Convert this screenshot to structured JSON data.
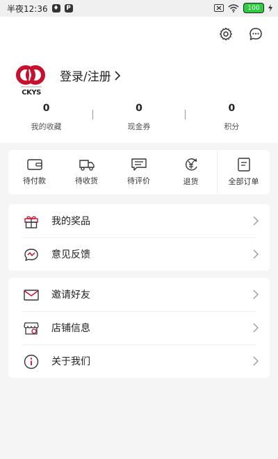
{
  "status_bar": {
    "time": "半夜12:36",
    "badge1": "♦",
    "badge2": "P",
    "battery": "100"
  },
  "header": {
    "settings_icon": "gear-icon",
    "message_icon": "chat-bubble-icon"
  },
  "profile": {
    "logo_text": "CKYS",
    "login_label": "登录/注册"
  },
  "stats": [
    {
      "value": "0",
      "label": "我的收藏"
    },
    {
      "value": "0",
      "label": "现金券"
    },
    {
      "value": "0",
      "label": "积分"
    }
  ],
  "orders": [
    {
      "label": "待付款",
      "icon": "wallet-icon"
    },
    {
      "label": "待收货",
      "icon": "truck-icon"
    },
    {
      "label": "待评价",
      "icon": "comment-icon"
    },
    {
      "label": "退货",
      "icon": "refund-icon"
    },
    {
      "label": "全部订单",
      "icon": "document-icon"
    }
  ],
  "menu_group1": [
    {
      "label": "我的奖品",
      "icon": "gift-icon"
    },
    {
      "label": "意见反馈",
      "icon": "feedback-icon"
    }
  ],
  "menu_group2": [
    {
      "label": "邀请好友",
      "icon": "mail-icon"
    },
    {
      "label": "店铺信息",
      "icon": "store-icon"
    },
    {
      "label": "关于我们",
      "icon": "info-icon"
    }
  ],
  "colors": {
    "accent": "#c8102e",
    "background": "#f5f5f5",
    "card": "#ffffff"
  }
}
